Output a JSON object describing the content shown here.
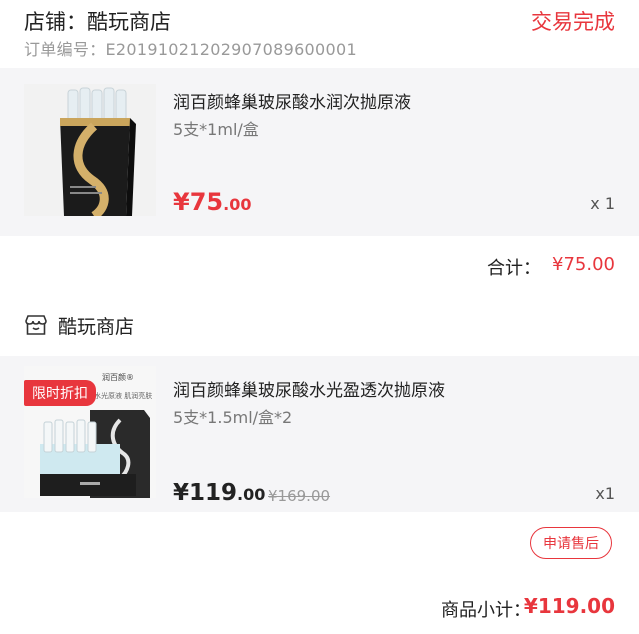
{
  "order": {
    "store_label": "店铺：酷玩商店",
    "status": "交易完成",
    "order_number": "订单编号：E20191021202907089600001"
  },
  "products": [
    {
      "name": "润百颜蜂巢玻尿酸水润次抛原液",
      "spec": "5支*1ml/盒",
      "price_int": "¥75",
      "price_dec": ".00",
      "quantity": "x 1"
    },
    {
      "name": "润百颜蜂巢玻尿酸水光盈透次抛原液",
      "spec": "5支*1.5ml/盒*2",
      "price_int": "¥119",
      "price_dec": ".00",
      "original_price": "¥169.00",
      "quantity": "x1",
      "badge": "限时折扣",
      "image_brand_text": "润百颜®",
      "image_tagline": "水光原液 肌润亮肤"
    }
  ],
  "subtotal": {
    "label": "合计：",
    "value": "¥75.00"
  },
  "store2": {
    "name": "酷玩商店"
  },
  "after_sale_button": "申请售后",
  "total": {
    "label": "商品小计：",
    "value": "¥119.00"
  },
  "colors": {
    "accent": "#e8363d",
    "card_bg": "#f5f5f7"
  }
}
